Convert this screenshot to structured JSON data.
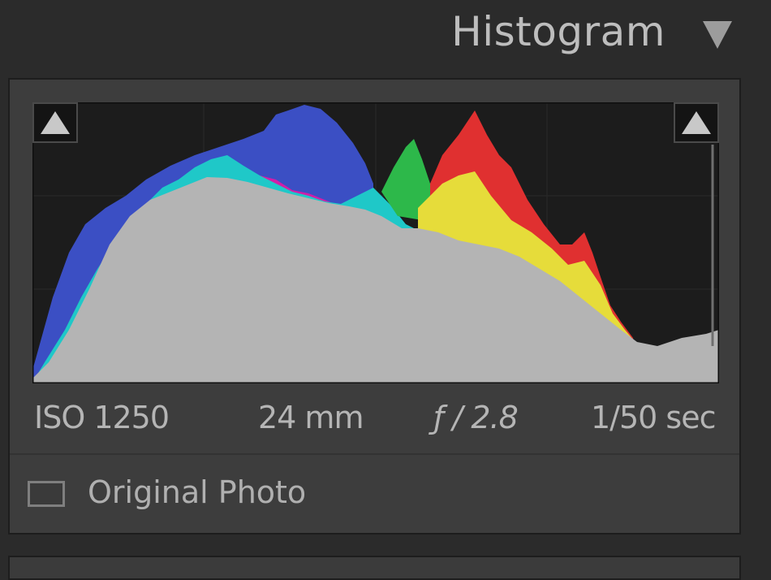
{
  "header": {
    "title": "Histogram"
  },
  "exif": {
    "iso": "ISO 1250",
    "focal_length": "24 mm",
    "aperture": "ƒ / 2.8",
    "shutter": "1/50 sec"
  },
  "original_photo": {
    "label": "Original Photo",
    "checked": false
  },
  "icons": {
    "collapse": "triangle-down-icon",
    "shadow_clip": "triangle-up-icon",
    "highlight_clip": "triangle-up-icon"
  },
  "colors": {
    "background": "#2b2b2b",
    "panel": "#3d3d3d",
    "histogram_bg": "#1c1c1c",
    "luminance": "#b4b4b4",
    "blue": "#3b4fc4",
    "cyan": "#1fc8c8",
    "green": "#2db84a",
    "red": "#e03030",
    "yellow": "#e6dc3a",
    "magenta": "#d21ea8"
  }
}
